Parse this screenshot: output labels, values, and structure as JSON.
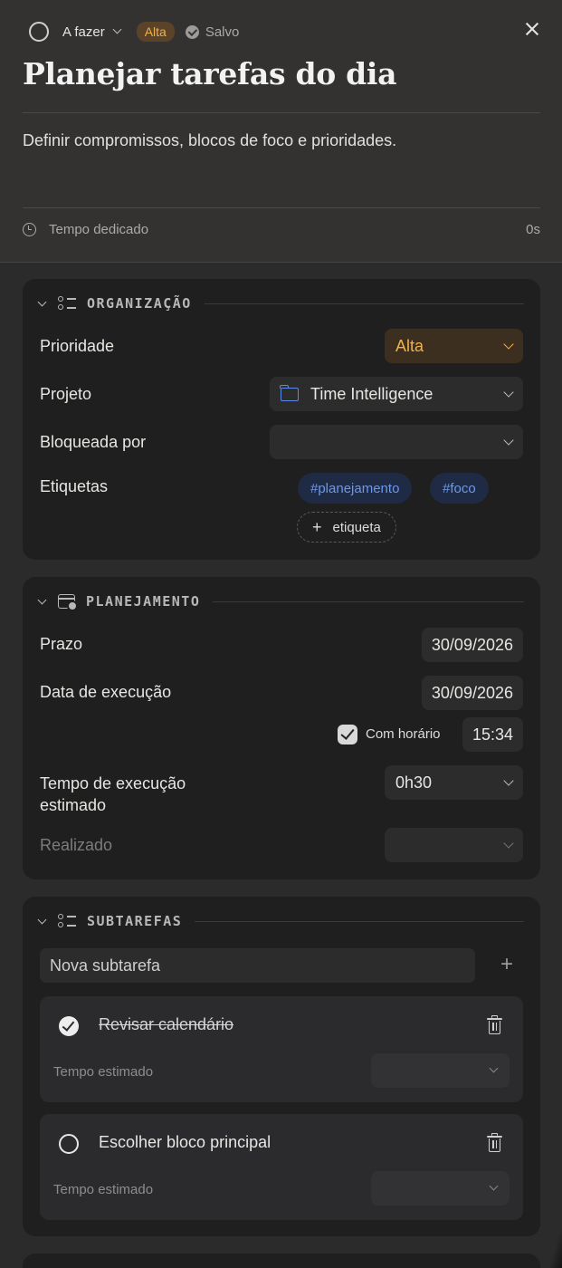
{
  "header": {
    "status_label": "A fazer",
    "priority_badge": "Alta",
    "saved_label": "Salvo",
    "title": "Planejar tarefas do dia",
    "description": "Definir compromissos, blocos de foco e prioridades.",
    "time_label": "Tempo dedicado",
    "time_value": "0s"
  },
  "organizacao": {
    "title": "ORGANIZAÇÃO",
    "priority_label": "Prioridade",
    "priority_value": "Alta",
    "project_label": "Projeto",
    "project_value": "Time Intelligence",
    "blocked_label": "Bloqueada por",
    "blocked_value": "",
    "tags_label": "Etiquetas",
    "tags": [
      "#planejamento",
      "#foco"
    ],
    "add_tag_label": "etiqueta"
  },
  "planejamento": {
    "title": "PLANEJAMENTO",
    "deadline_label": "Prazo",
    "deadline_value": "30/09/2026",
    "exec_date_label": "Data de execução",
    "exec_date_value": "30/09/2026",
    "with_time_label": "Com horário",
    "with_time_checked": true,
    "time_value": "15:34",
    "estimated_label": "Tempo de execução estimado",
    "estimated_value": "0h30",
    "done_label": "Realizado",
    "done_value": ""
  },
  "subtarefas": {
    "title": "SUBTAREFAS",
    "new_placeholder": "Nova subtarefa",
    "items": [
      {
        "title": "Revisar calendário",
        "done": true,
        "est_label": "Tempo estimado",
        "est_value": ""
      },
      {
        "title": "Escolher bloco principal",
        "done": false,
        "est_label": "Tempo estimado",
        "est_value": ""
      }
    ]
  },
  "colors": {
    "background": "#2b2b2b",
    "card": "#1f1f1f",
    "accent_orange": "#f0b04a",
    "tag_blue": "#6c98ea"
  }
}
